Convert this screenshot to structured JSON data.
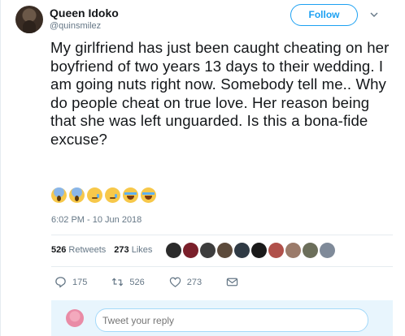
{
  "user": {
    "name": "Queen Idoko",
    "handle": "@quinsmilez"
  },
  "follow_label": "Follow",
  "tweet": {
    "text": "My girlfriend has just been caught cheating on her boyfriend of two years 13 days to their wedding. I am going nuts right now. Somebody tell me.. Why do people cheat on true love. Her reason being that she was left unguarded. Is this a bona-fide excuse?",
    "emojis": [
      "scream-emoji",
      "scream-emoji",
      "crying-emoji",
      "crying-emoji",
      "sob-emoji",
      "sob-emoji"
    ],
    "timestamp": "6:02 PM - 10 Jun 2018"
  },
  "stats": {
    "retweets_count": "526",
    "retweets_label": "Retweets",
    "likes_count": "273",
    "likes_label": "Likes",
    "liker_colors": [
      "#2b2b2b",
      "#7a1f2a",
      "#3d3d3d",
      "#5c4a3b",
      "#2f3a44",
      "#1a1a1a",
      "#b0504a",
      "#9b7b6a",
      "#6b6e5a",
      "#7f8a99"
    ]
  },
  "actions": {
    "replies": "175",
    "retweets": "526",
    "likes": "273"
  },
  "reply": {
    "placeholder": "Tweet your reply"
  },
  "colors": {
    "accent": "#1da1f2",
    "text": "#14171a",
    "muted": "#657786",
    "reply_bg": "#e8f5fd"
  }
}
